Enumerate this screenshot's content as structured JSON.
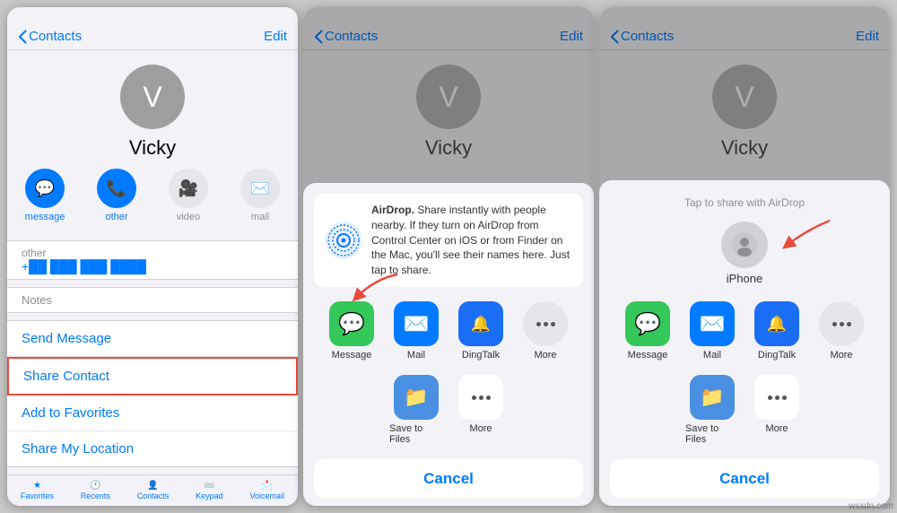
{
  "screens": [
    {
      "id": "screen1",
      "nav": {
        "back_label": "Contacts",
        "edit_label": "Edit"
      },
      "contact": {
        "initial": "V",
        "name": "Vicky"
      },
      "actions": [
        {
          "id": "message",
          "label": "message",
          "icon": "💬",
          "type": "blue"
        },
        {
          "id": "other",
          "label": "other",
          "icon": "📞",
          "type": "blue"
        },
        {
          "id": "video",
          "label": "video",
          "icon": "🎥",
          "type": "gray"
        },
        {
          "id": "mail",
          "label": "mail",
          "icon": "✉️",
          "type": "gray"
        }
      ],
      "other_label": "other",
      "other_value": "+██ ███ ███ ████",
      "notes_label": "Notes",
      "list_actions": [
        {
          "label": "Send Message",
          "highlighted": false
        },
        {
          "label": "Share Contact",
          "highlighted": true
        },
        {
          "label": "Add to Favorites",
          "highlighted": false
        },
        {
          "label": "Share My Location",
          "highlighted": false
        }
      ],
      "tabs": [
        "Favorites",
        "Recents",
        "Contacts",
        "Keypad",
        "Voicemail"
      ]
    },
    {
      "id": "screen2",
      "nav": {
        "back_label": "Contacts",
        "edit_label": "Edit"
      },
      "contact": {
        "initial": "V",
        "name": "Vicky"
      },
      "share_sheet": {
        "airdrop_title": "AirDrop.",
        "airdrop_text": "Share instantly with people nearby. If they turn on AirDrop from Control Center on iOS or from Finder on the Mac, you'll see their names here. Just tap to share.",
        "apps": [
          {
            "label": "Message",
            "type": "msg"
          },
          {
            "label": "Mail",
            "type": "mail"
          },
          {
            "label": "DingTalk",
            "type": "dingtalk"
          },
          {
            "label": "More",
            "type": "more"
          }
        ],
        "row_actions": [
          {
            "label": "Save to Files",
            "type": "files"
          },
          {
            "label": "More",
            "type": "moredots"
          }
        ],
        "cancel_label": "Cancel"
      }
    },
    {
      "id": "screen3",
      "nav": {
        "back_label": "Contacts",
        "edit_label": "Edit"
      },
      "contact": {
        "initial": "V",
        "name": "Vicky"
      },
      "share_sheet": {
        "airdrop_header": "Tap to share with AirDrop",
        "device": {
          "name": "iPhone"
        },
        "apps": [
          {
            "label": "Message",
            "type": "msg"
          },
          {
            "label": "Mail",
            "type": "mail"
          },
          {
            "label": "DingTalk",
            "type": "dingtalk"
          },
          {
            "label": "More",
            "type": "more"
          }
        ],
        "row_actions": [
          {
            "label": "Save to Files",
            "type": "files"
          },
          {
            "label": "More",
            "type": "moredots"
          }
        ],
        "cancel_label": "Cancel"
      }
    }
  ],
  "watermark": "wsxdn.com"
}
